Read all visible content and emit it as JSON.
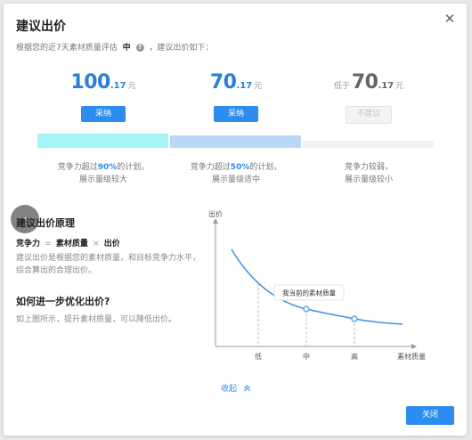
{
  "dialog": {
    "title": "建议出价",
    "close_symbol": "✕",
    "subtitle_before": "根据您的近7天素材质量评估",
    "quality_level": "中",
    "subtitle_after": "，建议出价如下："
  },
  "prices": [
    {
      "prefix": "",
      "int": "100",
      "dec": ".17",
      "unit": "元",
      "button": "采纳",
      "button_state": "primary",
      "desc_before": "竞争力超过",
      "desc_highlight": "90%",
      "desc_after": "的计划，",
      "desc_line2": "展示量级较大"
    },
    {
      "prefix": "",
      "int": "70",
      "dec": ".17",
      "unit": "元",
      "button": "采纳",
      "button_state": "primary",
      "desc_before": "竞争力超过",
      "desc_highlight": "50%",
      "desc_after": "的计划，",
      "desc_line2": "展示量级适中"
    },
    {
      "prefix": "低于",
      "int": "70",
      "dec": ".17",
      "unit": "元",
      "button": "不建议",
      "button_state": "disabled",
      "desc_before": "竞争力较弱，",
      "desc_highlight": "",
      "desc_after": "",
      "desc_line2": "展示量级较小"
    }
  ],
  "principle": {
    "title": "建议出价原理",
    "formula_a": "竞争力",
    "formula_eq": "=",
    "formula_b": "素材质量",
    "formula_x": "×",
    "formula_c": "出价",
    "text": "建议出价是根据您的素材质量，和目标竞争力水平，综合算出的合理出价。"
  },
  "optimize": {
    "title": "如何进一步优化出价?",
    "text": "如上图所示，提升素材质量，可以降低出价。"
  },
  "chart_data": {
    "type": "line",
    "ylabel": "出价",
    "xlabel": "素材质量",
    "categories": [
      "低",
      "中",
      "高"
    ],
    "tooltip": "我当前的素材质量",
    "highlight": "中",
    "axis_color": "#999999",
    "line_color": "#3a94e8"
  },
  "footer": {
    "collapse_label": "收起",
    "collapse_icon": "chevron-up-icon",
    "close_label": "关闭"
  },
  "colors": {
    "primary": "#2d8cf0",
    "bar_high": "#a5f4f6",
    "bar_mid": "#b9d8f8",
    "bar_low": "#f2f2f2"
  }
}
